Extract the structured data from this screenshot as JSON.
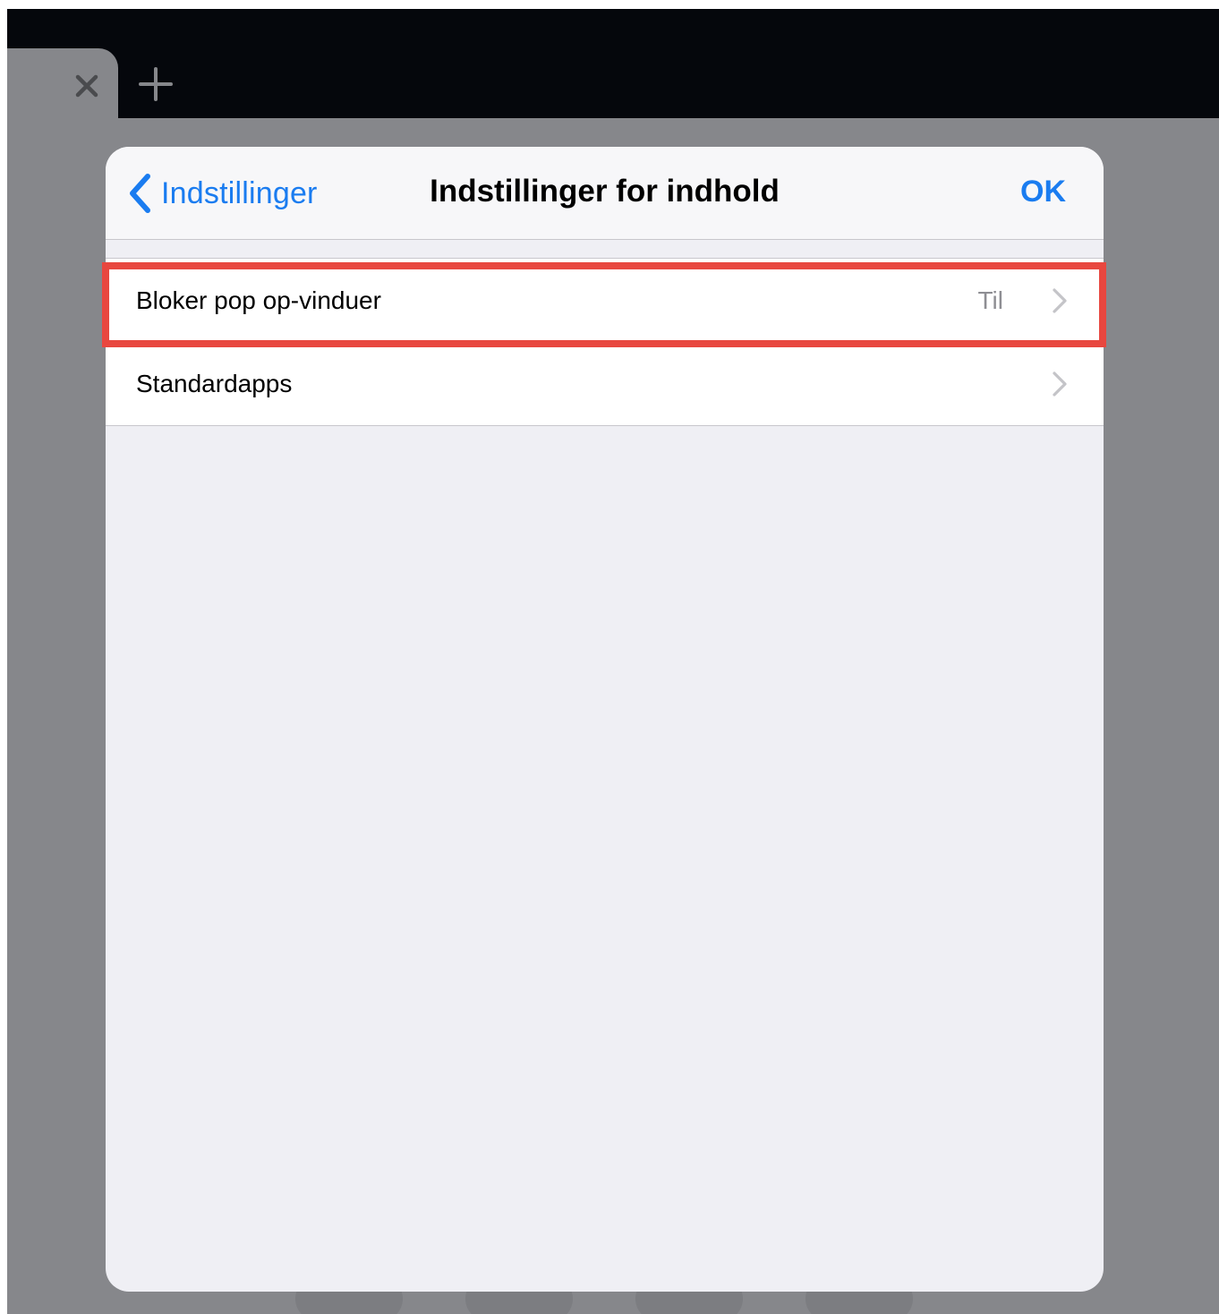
{
  "browser": {
    "close_tab_icon": "close-icon",
    "new_tab_icon": "plus-icon"
  },
  "nav": {
    "back_label": "Indstillinger",
    "title": "Indstillinger for indhold",
    "done_label": "OK"
  },
  "rows": [
    {
      "label": "Bloker pop op-vinduer",
      "value": "Til"
    },
    {
      "label": "Standardapps",
      "value": ""
    }
  ],
  "colors": {
    "accent": "#1a7cf0",
    "highlight": "#e8473f",
    "secondary_text": "#8e8e93",
    "dimmed_background": "#86878b"
  }
}
